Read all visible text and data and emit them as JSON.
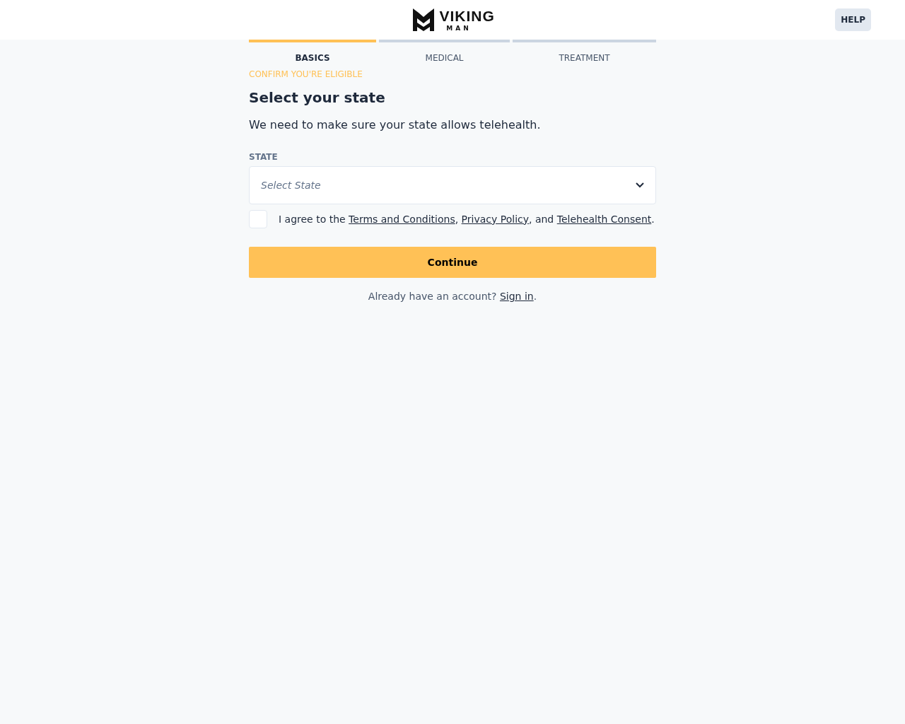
{
  "header": {
    "logo": {
      "word": "VIKING",
      "subword": "MAN"
    },
    "help_button": "HELP"
  },
  "steps": [
    {
      "label": "BASICS",
      "selected": true
    },
    {
      "label": "MEDICAL",
      "selected": false
    },
    {
      "label": "TREATMENT",
      "selected": false
    }
  ],
  "step_subtitle": "CONFIRM YOU'RE ELIGIBLE",
  "title": "Select your state",
  "description": "We need to make sure your state allows telehealth.",
  "state_field": {
    "label": "STATE",
    "placeholder": "Select State"
  },
  "agreement": {
    "checked": false,
    "parts": [
      {
        "kind": "text",
        "text": "I agree to the "
      },
      {
        "kind": "link",
        "text": "Terms and Conditions"
      },
      {
        "kind": "text",
        "text": ", "
      },
      {
        "kind": "link",
        "text": "Privacy Policy"
      },
      {
        "kind": "text",
        "text": ", and "
      },
      {
        "kind": "link",
        "text": "Telehealth Consent"
      },
      {
        "kind": "text",
        "text": "."
      }
    ]
  },
  "continue_button": "Continue",
  "signin": {
    "parts": [
      {
        "kind": "text",
        "text": "Already have an account? "
      },
      {
        "kind": "link",
        "text": "Sign in"
      },
      {
        "kind": "text",
        "text": "."
      }
    ]
  }
}
